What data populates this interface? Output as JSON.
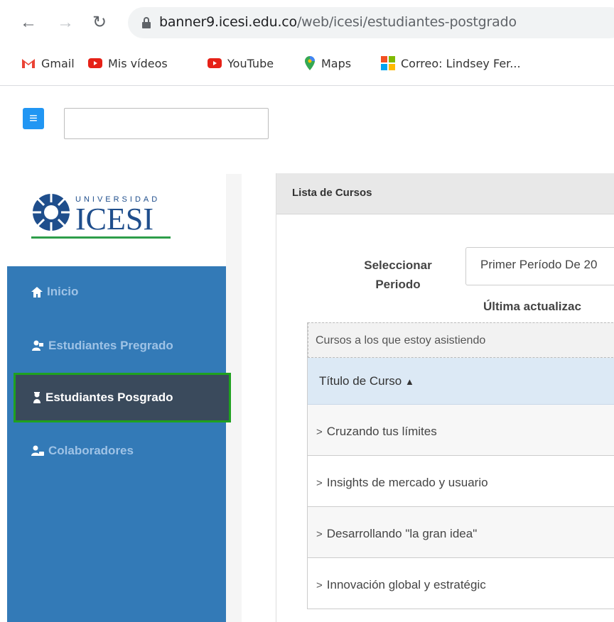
{
  "browser": {
    "url_host": "banner9.icesi.edu.co",
    "url_path": "/web/icesi/estudiantes-postgrado",
    "bookmarks": [
      {
        "label": "Gmail",
        "icon": "gmail-icon"
      },
      {
        "label": "Mis vídeos",
        "icon": "youtube-icon"
      },
      {
        "label": "YouTube",
        "icon": "youtube-icon"
      },
      {
        "label": "Maps",
        "icon": "maps-icon"
      },
      {
        "label": "Correo: Lindsey Fer...",
        "icon": "microsoft-icon"
      }
    ]
  },
  "toolbar": {
    "menu_icon": "≡"
  },
  "logo": {
    "top": "UNIVERSIDAD",
    "name": "ICESI"
  },
  "sidebar": {
    "items": [
      {
        "label": "Inicio",
        "icon": "home-icon"
      },
      {
        "label": "Estudiantes Pregrado",
        "icon": "student-icon"
      },
      {
        "label": "Estudiantes Posgrado",
        "icon": "graduate-icon"
      },
      {
        "label": "Colaboradores",
        "icon": "staff-icon"
      }
    ]
  },
  "main": {
    "panel_title": "Lista de Cursos",
    "select_label_1": "Seleccionar",
    "select_label_2": "Periodo",
    "period_value": "Primer Período De 20",
    "last_update": "Última actualizac",
    "table": {
      "caption": "Cursos a los que estoy asistiendo",
      "header": "Título de Curso",
      "rows": [
        "Cruzando tus límites",
        "Insights de mercado y usuario",
        "Desarrollando \"la gran idea\"",
        "Innovación global y estratégic"
      ]
    }
  },
  "colors": {
    "sidebar": "#337ab7",
    "active": "#3a4a5c",
    "accent": "#2196f3",
    "highlight": "#1fa11f"
  }
}
